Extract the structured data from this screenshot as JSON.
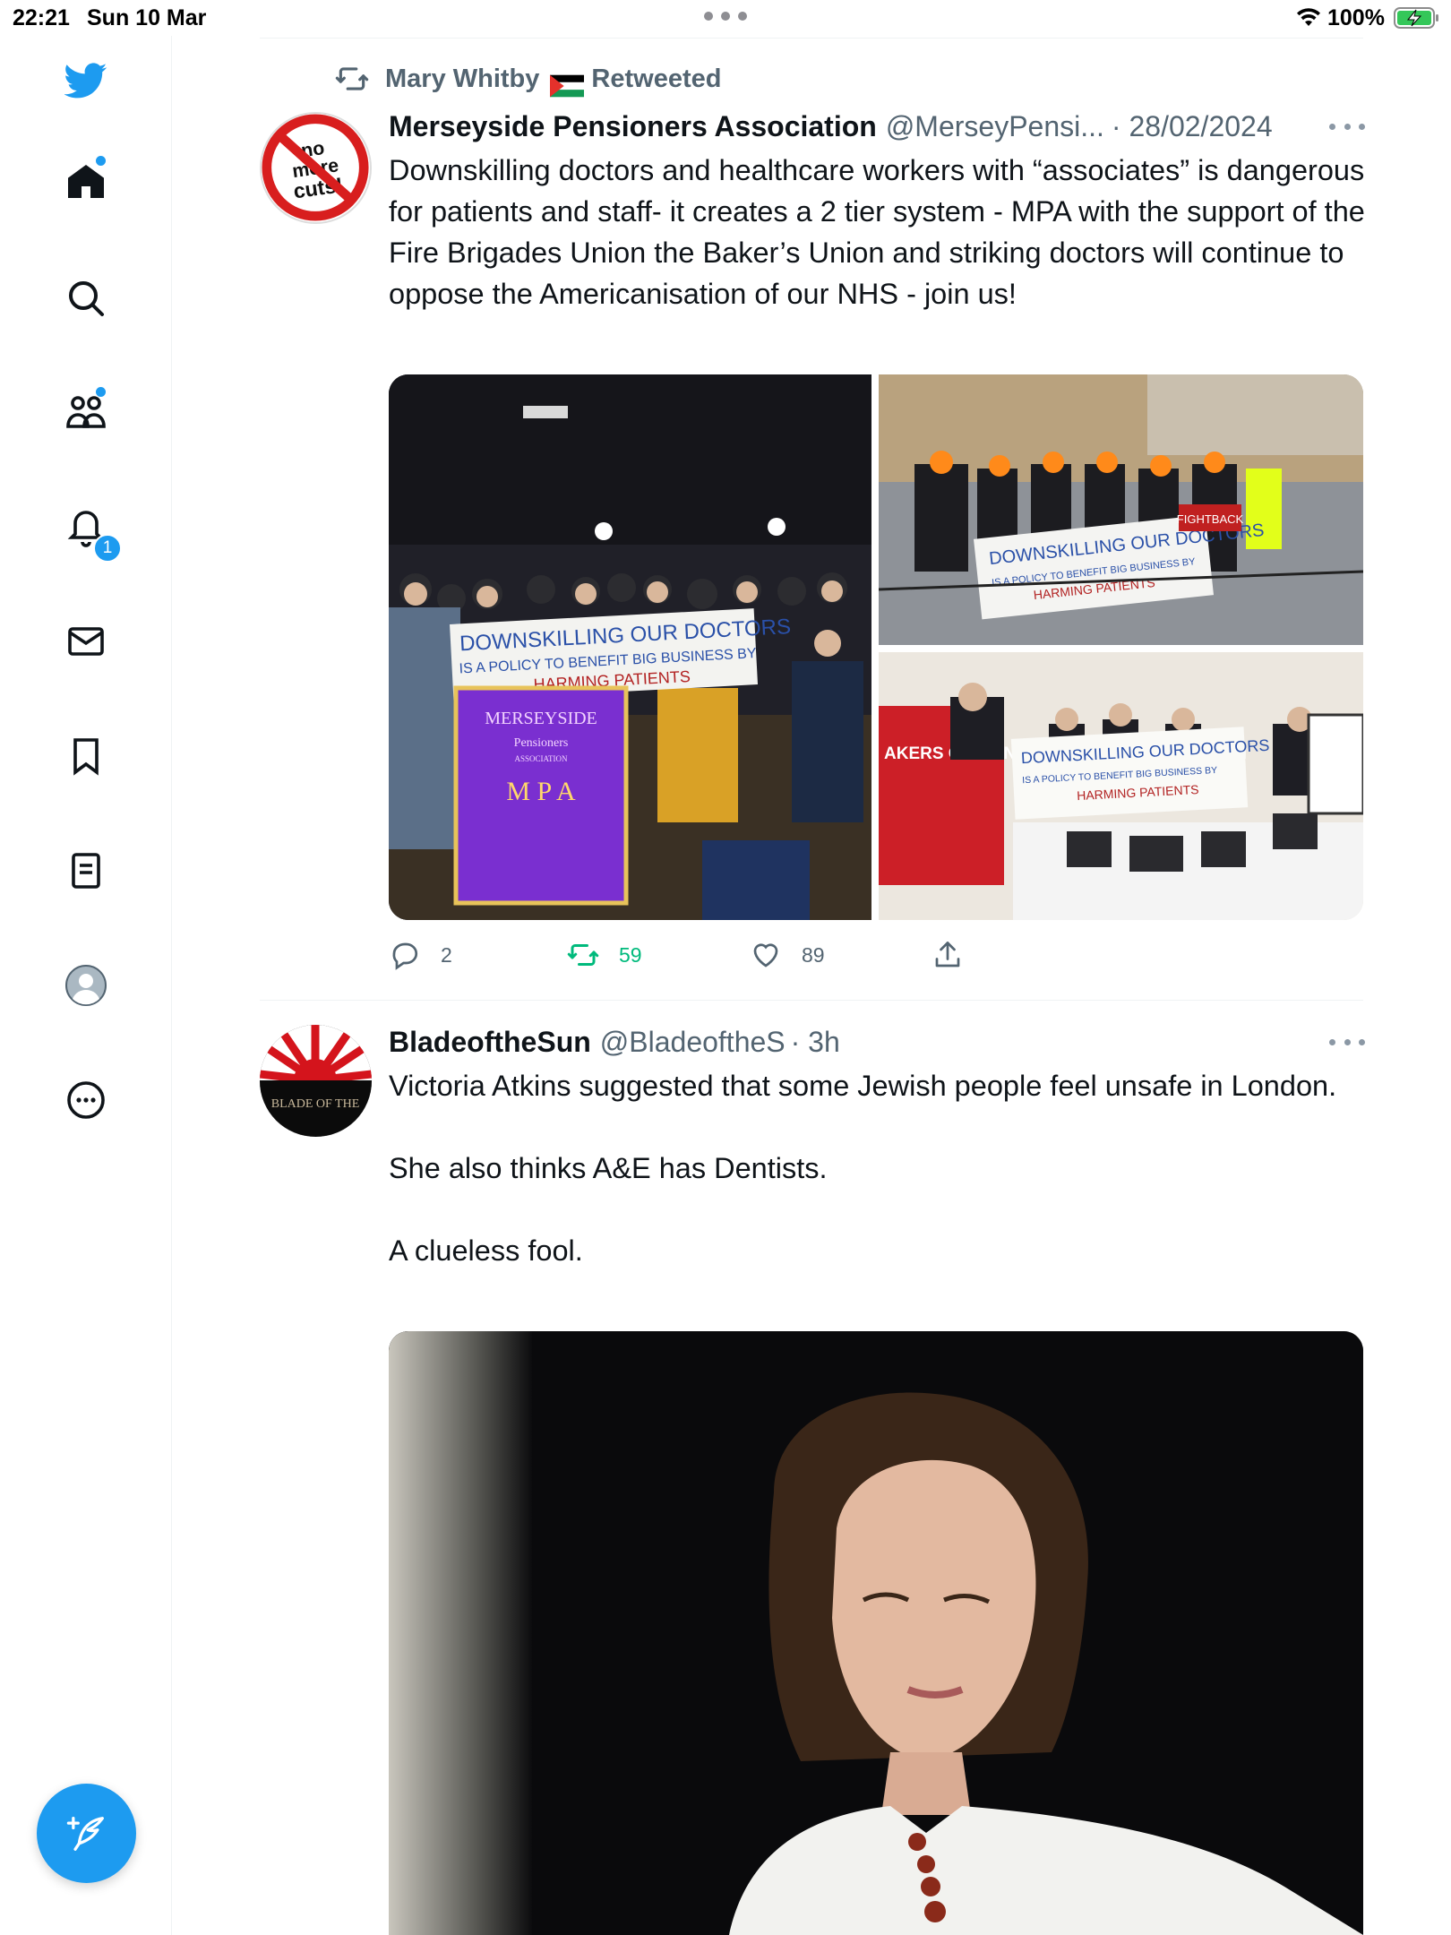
{
  "status_bar": {
    "time": "22:21",
    "date": "Sun 10 Mar",
    "battery_percent": "100%"
  },
  "sidebar": {
    "items": [
      {
        "name": "home",
        "icon": "home-icon",
        "has_dot": true
      },
      {
        "name": "explore",
        "icon": "search-icon"
      },
      {
        "name": "communities",
        "icon": "communities-icon",
        "has_dot": true
      },
      {
        "name": "notifications",
        "icon": "bell-icon",
        "badge": "1"
      },
      {
        "name": "messages",
        "icon": "mail-icon"
      },
      {
        "name": "bookmarks",
        "icon": "bookmark-icon"
      },
      {
        "name": "lists",
        "icon": "lists-icon"
      },
      {
        "name": "profile",
        "icon": "profile-avatar-icon"
      },
      {
        "name": "more",
        "icon": "more-circle-icon"
      }
    ]
  },
  "tweets": [
    {
      "retweet_by": "Mary Whitby",
      "retweet_label": "Retweeted",
      "author_name": "Merseyside Pensioners Association",
      "handle": "@MerseyPensi...",
      "time": "· 28/02/2024",
      "text": "Downskilling doctors and healthcare workers with “associates” is dangerous for patients and staff- it creates a 2 tier system - MPA with the support of the Fire Brigades Union the Baker’s Union and striking doctors will continue to oppose the Americanisation of our NHS - join us!",
      "media": [
        {
          "banner_line1": "DOWNSKILLING OUR DOCTORS",
          "banner_line2": "IS A POLICY TO BENEFIT BIG BUSINESS BY",
          "banner_line3": "HARMING PATIENTS",
          "flag_title": "MERSEYSIDE",
          "flag_sub": "Pensioners",
          "flag_sub2": "ASSOCIATION",
          "flag_initials": "M P A"
        },
        {
          "banner_line1": "DOWNSKILLING OUR DOCTORS",
          "banner_line2": "IS A POLICY TO BENEFIT BIG BUSINESS BY",
          "banner_line3": "HARMING PATIENTS",
          "sign": "FIGHTBACK"
        },
        {
          "banner_line1": "DOWNSKILLING OUR DOCTORS",
          "banner_line2": "IS A POLICY TO BENEFIT BIG BUSINESS BY",
          "banner_line3": "HARMING PATIENTS",
          "union_text": "AKERS OOD AND ALLIED WORKERS UNION"
        }
      ],
      "replies": "2",
      "retweets": "59",
      "likes": "89"
    },
    {
      "author_name": "BladeoftheSun",
      "handle": "@BladeoftheS",
      "time": "· 3h",
      "text": "Victoria Atkins suggested that some Jewish people feel unsafe in London.\n\nShe also thinks A&E has Dentists.\n\nA clueless fool.",
      "avatar_text": "BLADE OF THE"
    }
  ],
  "colors": {
    "accent": "#1d9bf0",
    "retweet_green": "#00ba7c",
    "text_secondary": "#536471"
  }
}
